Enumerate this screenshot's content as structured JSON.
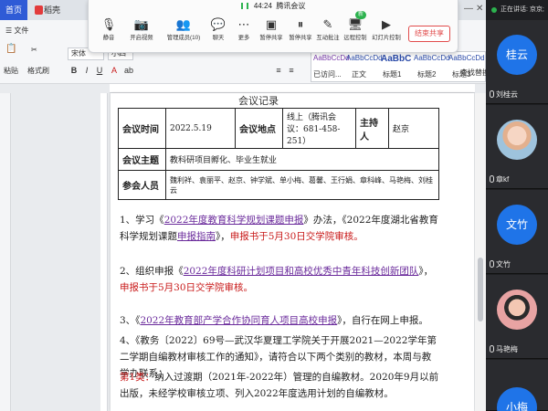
{
  "tabs": {
    "home": "首页",
    "doc": "稻壳"
  },
  "ribbon": {
    "file": "文件",
    "paste": "粘贴",
    "format_painter": "格式刷",
    "font_name": "宋体",
    "font_size": "小四",
    "styles": [
      {
        "preview": "AaBbCcDd",
        "label": "已访问..."
      },
      {
        "preview": "AaBbCcDd",
        "label": "正文"
      },
      {
        "preview": "AaBbC",
        "label": "标题1"
      },
      {
        "preview": "AaBbCcDd",
        "label": "标题2"
      },
      {
        "preview": "AaBbCcDd",
        "label": "标题3"
      }
    ],
    "text_layout": "文字排版",
    "find_replace": "查找替换"
  },
  "meeting": {
    "time": "44:24",
    "title": "腾讯会议",
    "buttons": [
      {
        "label": "静音",
        "icon": "mic-icon"
      },
      {
        "label": "开启视频",
        "icon": "camera-icon"
      },
      {
        "label": "管理成员(10)",
        "icon": "members-icon"
      },
      {
        "label": "聊天",
        "icon": "chat-icon"
      },
      {
        "label": "更多",
        "icon": "more-icon"
      },
      {
        "label": "暂停共享",
        "icon": "pause-icon"
      },
      {
        "label": "暂停共享",
        "icon": "pause-share-icon"
      },
      {
        "label": "互动批注",
        "icon": "annotate-icon"
      },
      {
        "label": "远程控制",
        "icon": "remote-icon"
      },
      {
        "label": "幻灯片控制",
        "icon": "slides-icon"
      }
    ],
    "badge": "新",
    "end_share": "结束共享"
  },
  "document": {
    "title": "会议记录",
    "table": {
      "time_label": "会议时间",
      "time_value": "2022.5.19",
      "place_label": "会议地点",
      "place_value": "线上（腾讯会议：681-458-251）",
      "host_label": "主持人",
      "host_value": "赵京",
      "topic_label": "会议主题",
      "topic_value": "教科研项目孵化、毕业生就业",
      "attendees_label": "参会人员",
      "attendees_value": "魏利祥、袁丽平、赵京、钟学斌、单小梅、葛馨、王行娟、章科峰、马艳梅、刘桂云"
    },
    "p1": {
      "a": "1、学习《",
      "link1": "2022年度教育科学规划课题申报",
      "b": "》办法，《2022年度湖北省教育科学规划课题",
      "link2": "申报指南",
      "c": "》，",
      "red": "申报书于5月30日交学院审核。"
    },
    "p2": {
      "a": "2、组织申报《",
      "link": "2022年度科研计划项目和高校优秀中青年科技创新团队",
      "b": "》，",
      "red": "申报书于5月30日交学院审核。"
    },
    "p3": {
      "a": "3、《",
      "link": "2022年教育部产学合作协同育人项目高校申报",
      "b": "》，自行在网上申报。"
    },
    "p4": {
      "text": "4、《教务〔2022〕69号—武汉华夏理工学院关于开展2021—2022学年第二学期自编教材审核工作的通知》，请符合以下两个类别的教材，本周与教学办联系："
    },
    "p5": {
      "red": "第1类：",
      "text": "纳入过渡期（2021年-2022年）管理的自编教材。2020年9月以前出版，未经学校审核立项、列入2022年度选用计划的自编教材。"
    }
  },
  "panel": {
    "speaking": "正在讲话: 京京;",
    "participants": [
      {
        "name": "刘桂云",
        "avatar_text": "桂云",
        "type": "text"
      },
      {
        "name": "章kf",
        "avatar_text": "",
        "type": "photo"
      },
      {
        "name": "文竹",
        "avatar_text": "文竹",
        "type": "text"
      },
      {
        "name": "马艳梅",
        "avatar_text": "",
        "type": "photo2"
      },
      {
        "name": "",
        "avatar_text": "小梅",
        "type": "text"
      }
    ]
  }
}
